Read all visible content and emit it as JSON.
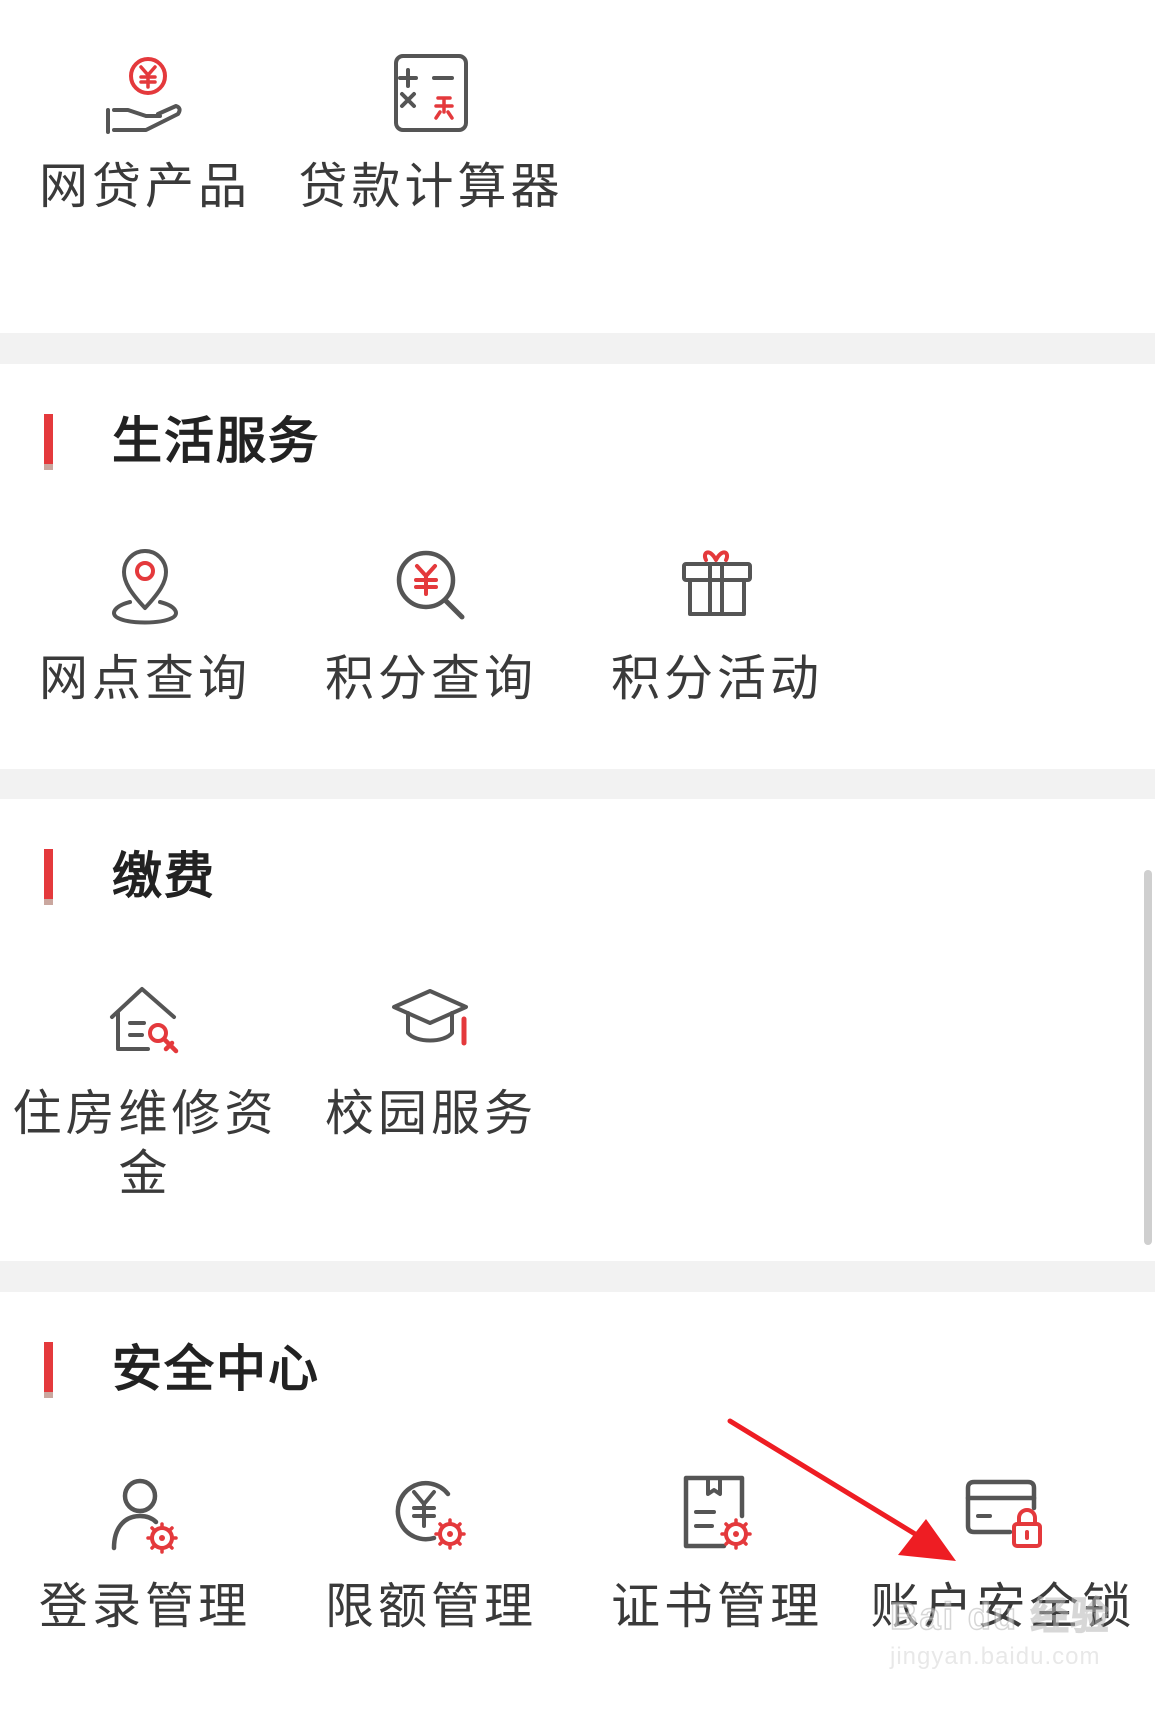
{
  "loan": {
    "items": [
      {
        "label": "网贷产品",
        "icon": "hand-yuan-icon"
      },
      {
        "label": "贷款计算器",
        "icon": "calculator-icon"
      }
    ]
  },
  "life": {
    "title": "生活服务",
    "items": [
      {
        "label": "网点查询",
        "icon": "location-pin-icon"
      },
      {
        "label": "积分查询",
        "icon": "search-yuan-icon"
      },
      {
        "label": "积分活动",
        "icon": "gift-icon"
      }
    ]
  },
  "pay": {
    "title": "缴费",
    "items": [
      {
        "label": "住房维修资金",
        "icon": "house-repair-icon"
      },
      {
        "label": "校园服务",
        "icon": "graduation-cap-icon"
      }
    ]
  },
  "security": {
    "title": "安全中心",
    "items": [
      {
        "label": "登录管理",
        "icon": "user-gear-icon"
      },
      {
        "label": "限额管理",
        "icon": "yuan-gear-icon"
      },
      {
        "label": "证书管理",
        "icon": "certificate-gear-icon"
      },
      {
        "label": "账户安全锁",
        "icon": "card-lock-icon"
      }
    ]
  },
  "watermark": {
    "main": "Bai du 经验",
    "sub": "jingyan.baidu.com"
  },
  "colors": {
    "accent": "#e4393c",
    "icon_gray": "#555555",
    "divider": "#f2f2f2"
  }
}
